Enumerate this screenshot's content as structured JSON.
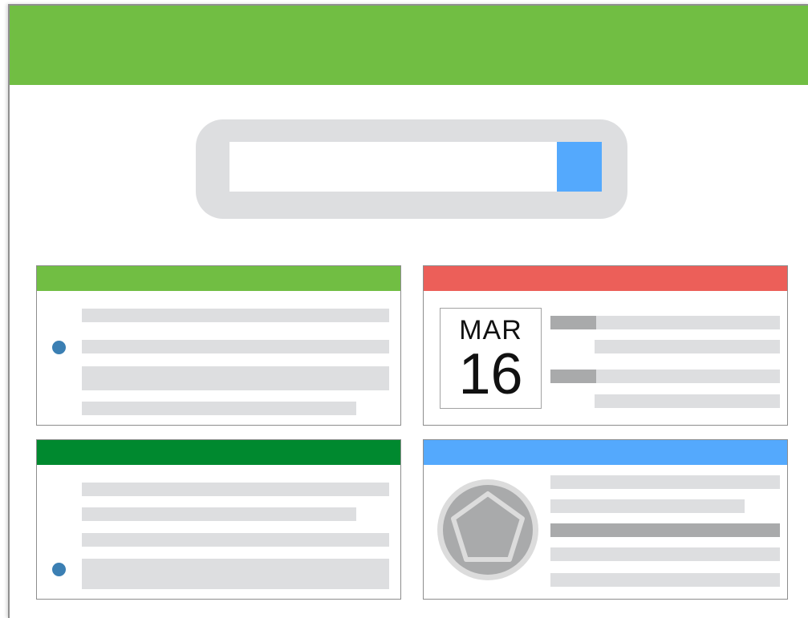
{
  "colors": {
    "brand_green": "#71be43",
    "search_button": "#54a9fd",
    "card_header_1": "#71be43",
    "card_header_2": "#ec5f59",
    "card_header_3": "#00892f",
    "card_header_4": "#54a9fd",
    "bullet": "#3b7fb3",
    "placeholder_bar": "#dddee0",
    "placeholder_bar_dark": "#a9aaab",
    "avatar": "#a9aaab"
  },
  "search": {
    "value": "",
    "placeholder": ""
  },
  "calendar": {
    "month": "MAR",
    "day": "16"
  },
  "icons": {
    "search_button": "blue-square-search-icon",
    "avatar": "pentagon-avatar-icon"
  }
}
